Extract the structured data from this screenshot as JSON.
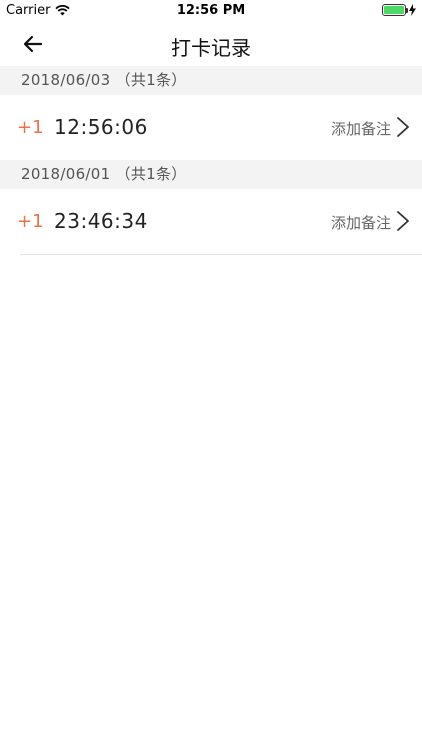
{
  "status_bar": {
    "carrier": "Carrier",
    "time": "12:56 PM",
    "battery_color": "#4cd964"
  },
  "nav": {
    "title": "打卡记录"
  },
  "sections": [
    {
      "date_label": "2018/06/03 （共1条）",
      "records": [
        {
          "plus": "+1",
          "time": "12:56:06",
          "note_label": "添加备注"
        }
      ]
    },
    {
      "date_label": "2018/06/01 （共1条）",
      "records": [
        {
          "plus": "+1",
          "time": "23:46:34",
          "note_label": "添加备注"
        }
      ]
    }
  ],
  "colors": {
    "accent": "#e8734a",
    "section_bg": "#f3f3f3"
  }
}
